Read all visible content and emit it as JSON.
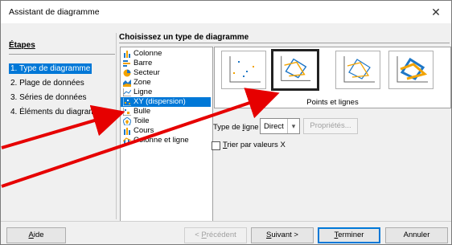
{
  "window": {
    "title": "Assistant de diagramme",
    "close_glyph": "✕"
  },
  "steps": {
    "title": "Étapes",
    "items": [
      {
        "label": "1. Type de diagramme",
        "selected": true
      },
      {
        "label": "2. Plage de données",
        "selected": false
      },
      {
        "label": "3. Séries de données",
        "selected": false
      },
      {
        "label": "4. Éléments du diagramme",
        "selected": false
      }
    ]
  },
  "chart_types": {
    "heading": "Choisissez un type de diagramme",
    "items": [
      {
        "label": "Colonne",
        "icon": "column-chart-icon"
      },
      {
        "label": "Barre",
        "icon": "bar-chart-icon"
      },
      {
        "label": "Secteur",
        "icon": "pie-chart-icon"
      },
      {
        "label": "Zone",
        "icon": "area-chart-icon"
      },
      {
        "label": "Ligne",
        "icon": "line-chart-icon"
      },
      {
        "label": "XY (dispersion)",
        "icon": "xy-scatter-icon",
        "selected": true
      },
      {
        "label": "Bulle",
        "icon": "bubble-chart-icon"
      },
      {
        "label": "Toile",
        "icon": "net-chart-icon"
      },
      {
        "label": "Cours",
        "icon": "stock-chart-icon"
      },
      {
        "label": "Colonne et ligne",
        "icon": "column-line-chart-icon"
      }
    ]
  },
  "variants": {
    "selected_label": "Points et lignes",
    "items": [
      {
        "name": "points-only",
        "icon": "scatter-points-icon"
      },
      {
        "name": "points-and-lines",
        "icon": "scatter-points-lines-icon",
        "selected": true
      },
      {
        "name": "lines-only",
        "icon": "scatter-lines-icon"
      },
      {
        "name": "3d-lines",
        "icon": "scatter-3d-lines-icon"
      }
    ]
  },
  "options": {
    "line_type_label": "Type de ligne",
    "line_type_value": "Direct",
    "properties_label": "Propriétés...",
    "sort_label": "Trier par valeurs X",
    "sort_checked": false
  },
  "buttons": {
    "help": "Aide",
    "previous": "< Précédent",
    "next": "Suivant >",
    "finish": "Terminer",
    "cancel": "Annuler"
  },
  "colors": {
    "selection": "#0078d7",
    "annotation_arrow": "#e60000"
  }
}
